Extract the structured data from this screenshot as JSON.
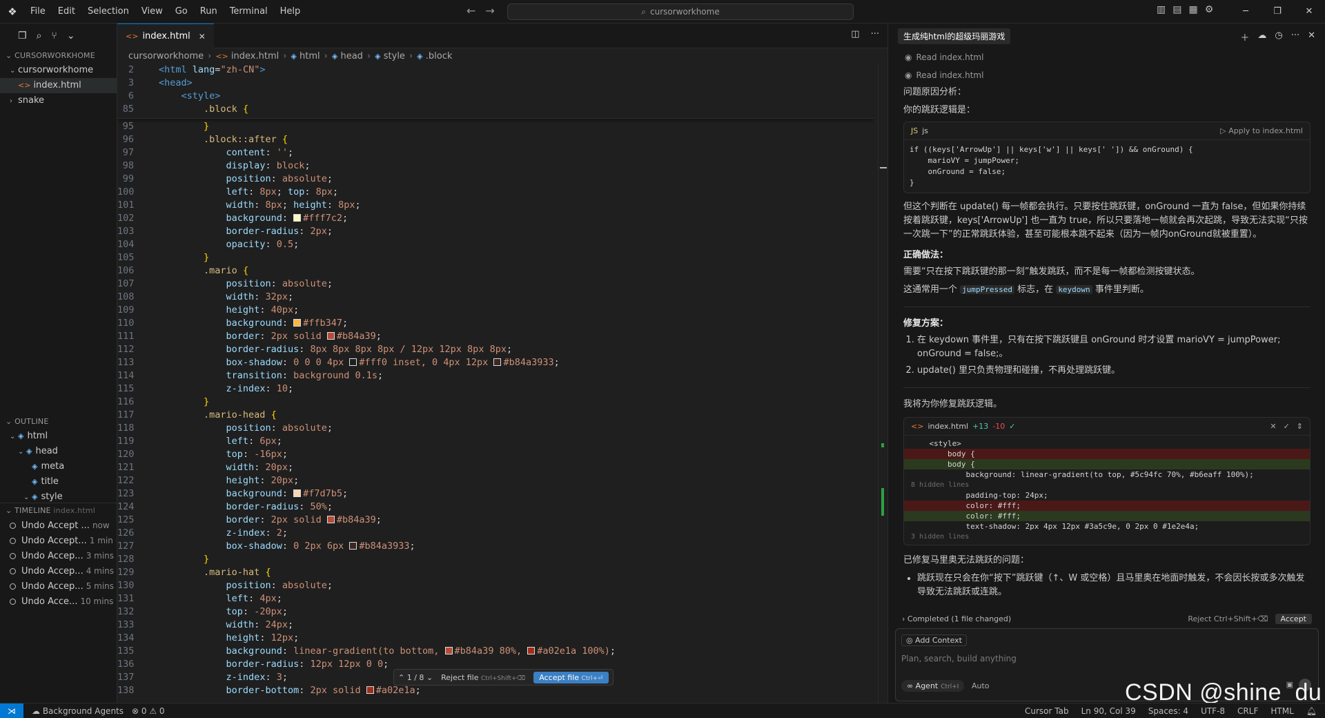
{
  "menu": [
    "File",
    "Edit",
    "Selection",
    "View",
    "Go",
    "Run",
    "Terminal",
    "Help"
  ],
  "search": {
    "text": "cursorworkhome"
  },
  "sidebar": {
    "explorer_title": "CURSORWORKHOME",
    "root_folder": "cursorworkhome",
    "files": [
      "index.html",
      "snake"
    ],
    "outline_title": "OUTLINE",
    "outline": [
      "html",
      "head",
      "meta",
      "title",
      "style"
    ],
    "timeline_title": "TIMELINE",
    "timeline_file": "index.html",
    "timeline": [
      {
        "label": "Undo Accept ...",
        "time": "now"
      },
      {
        "label": "Undo Accept...",
        "time": "1 min"
      },
      {
        "label": "Undo Accep...",
        "time": "3 mins"
      },
      {
        "label": "Undo Accep...",
        "time": "4 mins"
      },
      {
        "label": "Undo Accep...",
        "time": "5 mins"
      },
      {
        "label": "Undo Acce...",
        "time": "10 mins"
      }
    ]
  },
  "editor": {
    "tab": "index.html",
    "breadcrumb": [
      "cursorworkhome",
      "index.html",
      "html",
      "head",
      "style",
      ".block"
    ],
    "sticky": [
      {
        "n": "2",
        "t": "<html lang=\"zh-CN\">"
      },
      {
        "n": "3",
        "t": "<head>"
      },
      {
        "n": "6",
        "t": "    <style>"
      },
      {
        "n": "85",
        "t": "        .block {"
      }
    ],
    "lines": [
      {
        "n": "95",
        "t": "        }"
      },
      {
        "n": "96",
        "t": "        .block::after {"
      },
      {
        "n": "97",
        "t": "            content: '';"
      },
      {
        "n": "98",
        "t": "            display: block;"
      },
      {
        "n": "99",
        "t": "            position: absolute;"
      },
      {
        "n": "100",
        "t": "            left: 8px; top: 8px;"
      },
      {
        "n": "101",
        "t": "            width: 8px; height: 8px;"
      },
      {
        "n": "102",
        "t": "            background: #fff7c2;",
        "sw": "#fff7c2"
      },
      {
        "n": "103",
        "t": "            border-radius: 2px;"
      },
      {
        "n": "104",
        "t": "            opacity: 0.5;"
      },
      {
        "n": "105",
        "t": "        }"
      },
      {
        "n": "106",
        "t": "        .mario {"
      },
      {
        "n": "107",
        "t": "            position: absolute;"
      },
      {
        "n": "108",
        "t": "            width: 32px;"
      },
      {
        "n": "109",
        "t": "            height: 40px;"
      },
      {
        "n": "110",
        "t": "            background: #ffb347;",
        "sw": "#ffb347"
      },
      {
        "n": "111",
        "t": "            border: 2px solid #b84a39;",
        "sw": "#b84a39"
      },
      {
        "n": "112",
        "t": "            border-radius: 8px 8px 8px 8px / 12px 12px 8px 8px;"
      },
      {
        "n": "113",
        "t": "            box-shadow: 0 0 0 4px #fff0 inset, 0 4px 12px #b84a3933;"
      },
      {
        "n": "114",
        "t": "            transition: background 0.1s;"
      },
      {
        "n": "115",
        "t": "            z-index: 10;"
      },
      {
        "n": "116",
        "t": "        }"
      },
      {
        "n": "117",
        "t": "        .mario-head {"
      },
      {
        "n": "118",
        "t": "            position: absolute;"
      },
      {
        "n": "119",
        "t": "            left: 6px;"
      },
      {
        "n": "120",
        "t": "            top: -16px;"
      },
      {
        "n": "121",
        "t": "            width: 20px;"
      },
      {
        "n": "122",
        "t": "            height: 20px;"
      },
      {
        "n": "123",
        "t": "            background: #f7d7b5;",
        "sw": "#f7d7b5"
      },
      {
        "n": "124",
        "t": "            border-radius: 50%;"
      },
      {
        "n": "125",
        "t": "            border: 2px solid #b84a39;",
        "sw": "#b84a39"
      },
      {
        "n": "126",
        "t": "            z-index: 2;"
      },
      {
        "n": "127",
        "t": "            box-shadow: 0 2px 6px #b84a3933;"
      },
      {
        "n": "128",
        "t": "        }"
      },
      {
        "n": "129",
        "t": "        .mario-hat {"
      },
      {
        "n": "130",
        "t": "            position: absolute;"
      },
      {
        "n": "131",
        "t": "            left: 4px;"
      },
      {
        "n": "132",
        "t": "            top: -20px;"
      },
      {
        "n": "133",
        "t": "            width: 24px;"
      },
      {
        "n": "134",
        "t": "            height: 12px;"
      },
      {
        "n": "135",
        "t": "            background: linear-gradient(to bottom, #b84a39 80%, #a02e1a 100%);"
      },
      {
        "n": "136",
        "t": "            border-radius: 12px 12px 0 0;"
      },
      {
        "n": "137",
        "t": "            z-index: 3;"
      },
      {
        "n": "138",
        "t": "            border-bottom: 2px solid #a02e1a;",
        "sw": "#a02e1a"
      }
    ],
    "float_bar": {
      "counter": "1 / 8",
      "reject": "Reject file",
      "reject_kbd": "Ctrl+Shift+⌫",
      "accept": "Accept file",
      "accept_kbd": "Ctrl+⏎"
    }
  },
  "chat": {
    "title": "生成纯html的超级玛丽游戏",
    "read1": "Read index.html",
    "read2": "Read index.html",
    "p1": "问题原因分析：",
    "p2": "你的跳跃逻辑是：",
    "code_lang": "js",
    "code_apply": "Apply to index.html",
    "code": "if ((keys['ArrowUp'] || keys['w'] || keys[' ']) && onGround) {\n    marioVY = jumpPower;\n    onGround = false;\n}",
    "p3": "但这个判断在 update() 每一帧都会执行。只要按住跳跃键，onGround 一直为 false，但如果你持续按着跳跃键，keys['ArrowUp'] 也一直为 true，所以只要落地一帧就会再次起跳，导致无法实现“只按一次跳一下”的正常跳跃体验，甚至可能根本跳不起来（因为一帧内onGround就被重置）。",
    "h_right": "正确做法：",
    "p4": "需要“只在按下跳跃键的那一刻”触发跳跃，而不是每一帧都检测按键状态。",
    "p5a": "这通常用一个",
    "p5_code1": "jumpPressed",
    "p5b": "标志，在",
    "p5_code2": "keydown",
    "p5c": "事件里判断。",
    "h_fix": "修复方案：",
    "fix1": "在 keydown 事件里，只有在按下跳跃键且 onGround 时才设置 marioVY = jumpPower; onGround = false;。",
    "fix2": "update() 里只负责物理和碰撞，不再处理跳跃键。",
    "p6": "我将为你修复跳跃逻辑。",
    "diff_file": "index.html",
    "diff_add": "+13",
    "diff_del": "-10",
    "diff_lines": [
      {
        "k": "",
        "t": "    <style>"
      },
      {
        "k": "r",
        "t": "        body {"
      },
      {
        "k": "a",
        "t": "        body {"
      },
      {
        "k": "",
        "t": "            background: linear-gradient(to top, #5c94fc 70%, #b6eaff 100%);"
      },
      {
        "k": "hid",
        "t": "8 hidden lines"
      },
      {
        "k": "",
        "t": "            padding-top: 24px;"
      },
      {
        "k": "r",
        "t": "            color: #fff;"
      },
      {
        "k": "a",
        "t": "            color: #fff;"
      },
      {
        "k": "",
        "t": "            text-shadow: 2px 4px 12px #3a5c9e, 0 2px 0 #1e2e4a;"
      },
      {
        "k": "hid",
        "t": "3 hidden lines"
      }
    ],
    "p7": "已修复马里奥无法跳跃的问题：",
    "done1": "跳跃现在只会在你“按下”跳跃键（↑、W 或空格）且马里奥在地面时触发，不会因长按或多次触发导致无法跳跃或连跳。",
    "completed": "Completed (1 file changed)",
    "reject_kbd": "Reject Ctrl+Shift+⌫",
    "accept": "Accept",
    "add_context": "Add Context",
    "placeholder": "Plan, search, build anything",
    "agent": "Agent",
    "agent_kbd": "Ctrl+I",
    "auto": "Auto"
  },
  "status": {
    "bg_agents": "Background Agents",
    "problems": "⊗ 0 ⚠ 0",
    "cursor_tab": "Cursor Tab",
    "position": "Ln 90, Col 39",
    "spaces": "Spaces: 4",
    "encoding": "UTF-8",
    "eol": "CRLF",
    "lang": "HTML"
  },
  "watermark": "CSDN @shine_du"
}
